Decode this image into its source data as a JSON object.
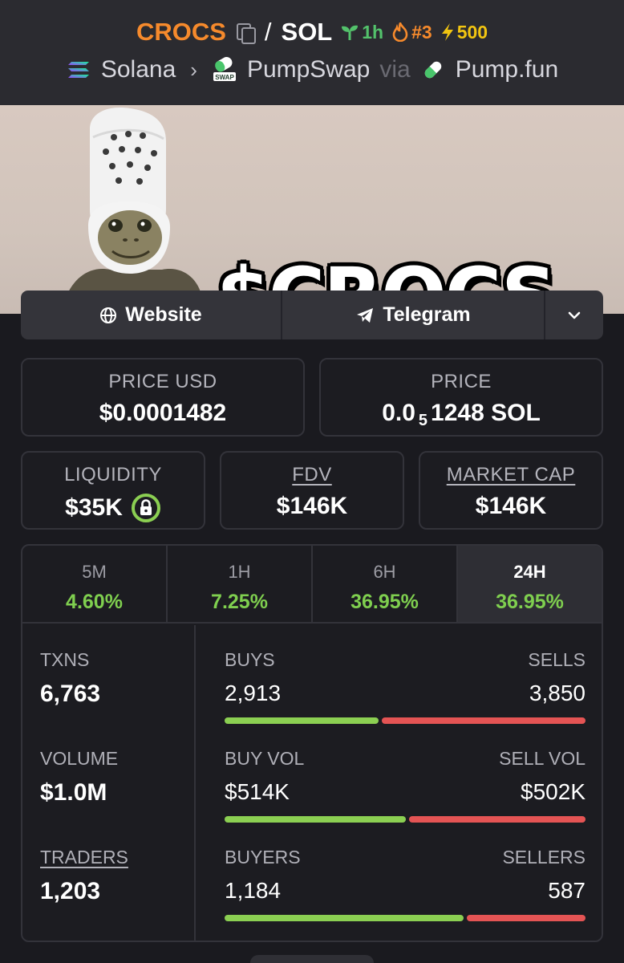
{
  "header": {
    "symbol": "CROCS",
    "quote": "SOL",
    "badges": {
      "age": "1h",
      "rank": "#3",
      "boost": "500"
    },
    "chain": "Solana",
    "dex": "PumpSwap",
    "via_label": "via",
    "launchpad": "Pump.fun"
  },
  "banner": {
    "text": "$CROCS"
  },
  "links": {
    "website": "Website",
    "telegram": "Telegram"
  },
  "price": {
    "usd_label": "PRICE USD",
    "usd_value": "$0.0001482",
    "native_label": "PRICE",
    "native_prefix": "0.0",
    "native_zeros": "5",
    "native_rest": "1248 SOL"
  },
  "metrics": {
    "liquidity_label": "LIQUIDITY",
    "liquidity_value": "$35K",
    "fdv_label": "FDV",
    "fdv_value": "$146K",
    "mcap_label": "MARKET CAP",
    "mcap_value": "$146K"
  },
  "timeframes": [
    {
      "label": "5M",
      "change": "4.60%"
    },
    {
      "label": "1H",
      "change": "7.25%"
    },
    {
      "label": "6H",
      "change": "36.95%"
    },
    {
      "label": "24H",
      "change": "36.95%"
    }
  ],
  "stats": {
    "txns_label": "TXNS",
    "txns_value": "6,763",
    "volume_label": "VOLUME",
    "volume_value": "$1.0M",
    "traders_label": "TRADERS",
    "traders_value": "1,203",
    "buys_label": "BUYS",
    "buys_value": "2,913",
    "sells_label": "SELLS",
    "sells_value": "3,850",
    "buyvol_label": "BUY VOL",
    "buyvol_value": "$514K",
    "sellvol_label": "SELL VOL",
    "sellvol_value": "$502K",
    "buyers_label": "BUYERS",
    "buyers_value": "1,184",
    "sellers_label": "SELLERS",
    "sellers_value": "587",
    "buy_fraction_txns": 0.431,
    "buy_fraction_vol": 0.506,
    "buy_fraction_traders": 0.669
  },
  "colors": {
    "accent": "#f68a2c",
    "positive": "#7fcf4f",
    "buy": "#8bcf52",
    "sell": "#e45454"
  }
}
